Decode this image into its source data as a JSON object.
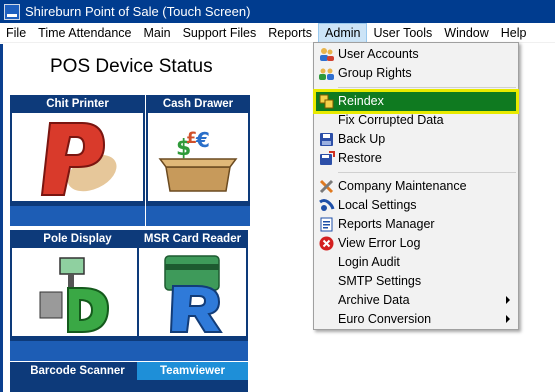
{
  "window": {
    "title": "Shireburn Point of Sale (Touch Screen)",
    "icon": "app-icon"
  },
  "menubar": {
    "items": [
      {
        "label": "File"
      },
      {
        "label": "Time Attendance"
      },
      {
        "label": "Main"
      },
      {
        "label": "Support Files"
      },
      {
        "label": "Reports"
      },
      {
        "label": "Admin",
        "active": true
      },
      {
        "label": "User Tools"
      },
      {
        "label": "Window"
      },
      {
        "label": "Help"
      }
    ]
  },
  "main": {
    "title": "POS Device Status",
    "tiles": [
      {
        "label": "Chit Printer",
        "icon": "chit-printer-icon"
      },
      {
        "label": "Cash Drawer",
        "icon": "cash-drawer-icon"
      },
      {
        "label": "Pole Display",
        "icon": "pole-display-icon"
      },
      {
        "label": "MSR Card Reader",
        "icon": "msr-card-reader-icon"
      },
      {
        "label": "Barcode Scanner",
        "icon": "barcode-scanner-icon"
      },
      {
        "label": "Teamviewer",
        "icon": "teamviewer-icon"
      }
    ]
  },
  "admin_menu": {
    "items": [
      {
        "label": "User Accounts",
        "icon": "users-icon"
      },
      {
        "label": "Group Rights",
        "icon": "group-icon"
      },
      {
        "label": "Reindex",
        "icon": "reindex-icon",
        "highlighted": true
      },
      {
        "label": "Fix Corrupted Data",
        "icon": ""
      },
      {
        "label": "Back Up",
        "icon": "backup-icon"
      },
      {
        "label": "Restore",
        "icon": "restore-icon"
      },
      {
        "label": "Company Maintenance",
        "icon": "tools-icon"
      },
      {
        "label": "Local Settings",
        "icon": "local-settings-icon"
      },
      {
        "label": "Reports Manager",
        "icon": "reports-manager-icon"
      },
      {
        "label": "View Error Log",
        "icon": "error-icon"
      },
      {
        "label": "Login Audit",
        "icon": ""
      },
      {
        "label": "SMTP Settings",
        "icon": ""
      },
      {
        "label": "Archive Data",
        "icon": "",
        "submenu": true
      },
      {
        "label": "Euro Conversion",
        "icon": "",
        "submenu": true
      }
    ]
  },
  "colors": {
    "titlebar": "#003c8f",
    "tile_header": "#0d3a7a",
    "tile_footer": "#1d5db5",
    "highlight": "#0f7a20",
    "highlight_outline": "#e8ea00"
  }
}
